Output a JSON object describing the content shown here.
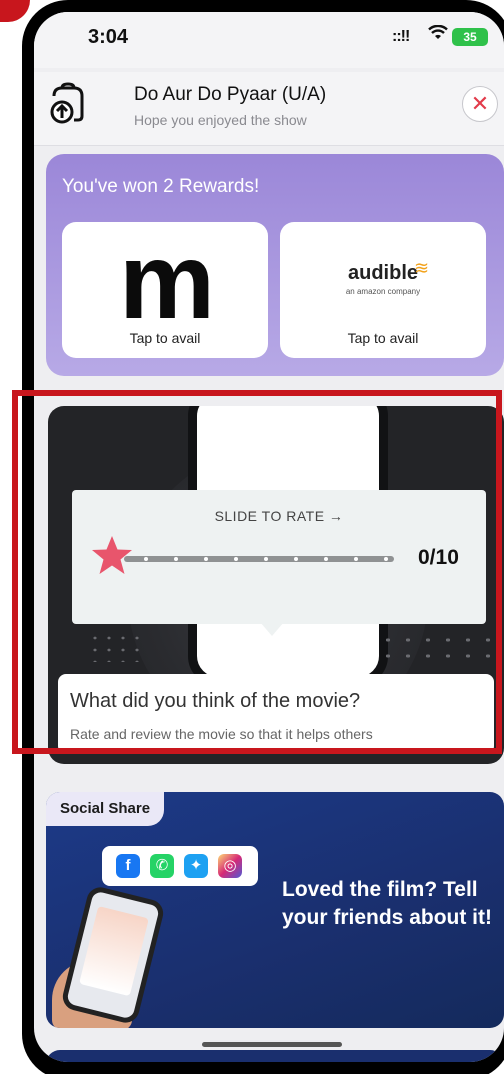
{
  "status_bar": {
    "time": "3:04",
    "signal": "::!!",
    "battery": "35"
  },
  "show_header": {
    "title": "Do Aur Do Pyaar (U/A)",
    "subtitle": "Hope you enjoyed the show",
    "close_symbol": "✕"
  },
  "rewards": {
    "title": "You've won 2 Rewards!",
    "cards": [
      {
        "logo_text": "m",
        "action": "Tap to avail"
      },
      {
        "logo_text": "audible",
        "logo_tagline": "an amazon company",
        "action": "Tap to avail"
      }
    ]
  },
  "rating": {
    "slide_label": "SLIDE TO RATE →",
    "score": "0/10",
    "question": "What did you think of the movie?",
    "subtext": "Rate and review the movie so that it helps others"
  },
  "social_share": {
    "tab_label": "Social Share",
    "headline": "Loved the film? Tell your friends about it!",
    "apps": [
      "facebook-icon",
      "whatsapp-icon",
      "twitter-icon",
      "instagram-icon"
    ]
  },
  "colors": {
    "highlight_border": "#c8161d",
    "rewards_bg": "#9b87d8",
    "rate_bg": "#232427",
    "social_bg": "#1c3a88",
    "star": "#e8556c"
  }
}
